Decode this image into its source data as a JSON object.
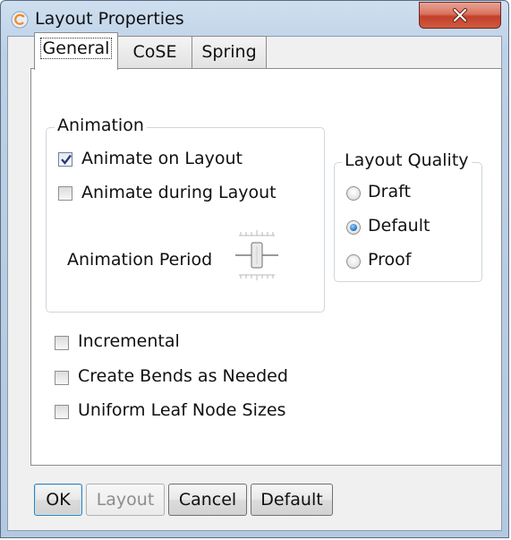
{
  "window": {
    "title": "Layout Properties",
    "close_symbol": "×"
  },
  "tabs": [
    {
      "label": "General",
      "active": true
    },
    {
      "label": "CoSE",
      "active": false
    },
    {
      "label": "Spring",
      "active": false
    }
  ],
  "animation_group": {
    "title": "Animation",
    "animate_on_layout": {
      "label": "Animate on Layout",
      "checked": true
    },
    "animate_during_layout": {
      "label": "Animate during Layout",
      "checked": false
    },
    "animation_period_label": "Animation Period",
    "animation_period_level": 0.5
  },
  "quality_group": {
    "title": "Layout Quality",
    "options": [
      {
        "label": "Draft",
        "selected": false
      },
      {
        "label": "Default",
        "selected": true
      },
      {
        "label": "Proof",
        "selected": false
      }
    ]
  },
  "options": [
    {
      "label": "Incremental",
      "checked": false
    },
    {
      "label": "Create Bends as Needed",
      "checked": false
    },
    {
      "label": "Uniform Leaf Node Sizes",
      "checked": false
    }
  ],
  "buttons": {
    "ok": "OK",
    "layout": "Layout",
    "cancel": "Cancel",
    "default": "Default"
  },
  "colors": {
    "radio_selected": "#1f6fc0",
    "close_button": "#c3402a"
  },
  "icons": {
    "app": "layout-app-icon",
    "close": "close-icon"
  }
}
